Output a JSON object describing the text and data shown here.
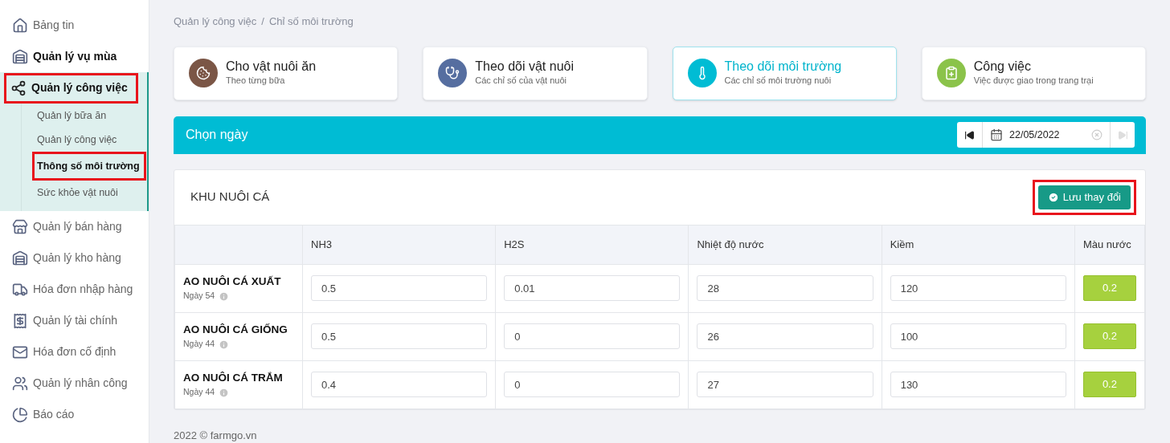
{
  "sidebar": {
    "items": [
      {
        "label": "Bảng tin",
        "selected": false,
        "emphasized": false,
        "highlighted": false
      },
      {
        "label": "Quản lý vụ mùa",
        "selected": false,
        "emphasized": true,
        "highlighted": false
      },
      {
        "label": "Quản lý công việc",
        "selected": true,
        "emphasized": true,
        "highlighted": true,
        "expanded": true,
        "children": [
          {
            "label": "Quản lý bữa ăn",
            "selected": false,
            "highlighted": false
          },
          {
            "label": "Quản lý công việc",
            "selected": false,
            "highlighted": false
          },
          {
            "label": "Thông số môi trường",
            "selected": true,
            "highlighted": true
          },
          {
            "label": "Sức khỏe vật nuôi",
            "selected": false,
            "highlighted": false
          }
        ]
      },
      {
        "label": "Quản lý bán hàng",
        "selected": false,
        "emphasized": false,
        "highlighted": false
      },
      {
        "label": "Quản lý kho hàng",
        "selected": false,
        "emphasized": false,
        "highlighted": false
      },
      {
        "label": "Hóa đơn nhập hàng",
        "selected": false,
        "emphasized": false,
        "highlighted": false
      },
      {
        "label": "Quản lý tài chính",
        "selected": false,
        "emphasized": false,
        "highlighted": false
      },
      {
        "label": "Hóa đơn cố định",
        "selected": false,
        "emphasized": false,
        "highlighted": false
      },
      {
        "label": "Quản lý nhân công",
        "selected": false,
        "emphasized": false,
        "highlighted": false
      },
      {
        "label": "Báo cáo",
        "selected": false,
        "emphasized": false,
        "highlighted": false
      }
    ]
  },
  "breadcrumb": [
    "Quản lý công việc",
    "Chỉ số môi trường"
  ],
  "breadcrumb_separator": "/",
  "cards": [
    {
      "title": "Cho vật nuôi ăn",
      "subtitle": "Theo từng bữa",
      "color": "#7b5646",
      "selected": false
    },
    {
      "title": "Theo dõi vật nuôi",
      "subtitle": "Các chỉ số của vật nuôi",
      "color": "#566ea0",
      "selected": false
    },
    {
      "title": "Theo dõi môi trường",
      "subtitle": "Các chỉ số môi trường nuôi",
      "color": "#00bcd4",
      "selected": true
    },
    {
      "title": "Công việc",
      "subtitle": "Việc được giao trong trang trại",
      "color": "#8bc34a",
      "selected": false
    }
  ],
  "date_bar": {
    "title": "Chọn ngày",
    "date": "22/05/2022"
  },
  "panel": {
    "title": "KHU NUÔI CÁ",
    "save_button": {
      "label": "Lưu thay đổi",
      "highlighted": true
    },
    "columns": [
      "NH3",
      "H2S",
      "Nhiệt độ nước",
      "Kiềm",
      "Màu nước"
    ],
    "rows": [
      {
        "name": "AO NUÔI CÁ XUẤT",
        "day": "Ngày 54",
        "values": [
          "0.5",
          "0.01",
          "28",
          "120"
        ],
        "water_color": "0.2"
      },
      {
        "name": "AO NUÔI CÁ GIỐNG",
        "day": "Ngày 44",
        "values": [
          "0.5",
          "0",
          "26",
          "100"
        ],
        "water_color": "0.2"
      },
      {
        "name": "AO NUÔI CÁ TRẮM",
        "day": "Ngày 44",
        "values": [
          "0.4",
          "0",
          "27",
          "130"
        ],
        "water_color": "0.2"
      }
    ]
  },
  "footer": "2022 © farmgo.vn"
}
